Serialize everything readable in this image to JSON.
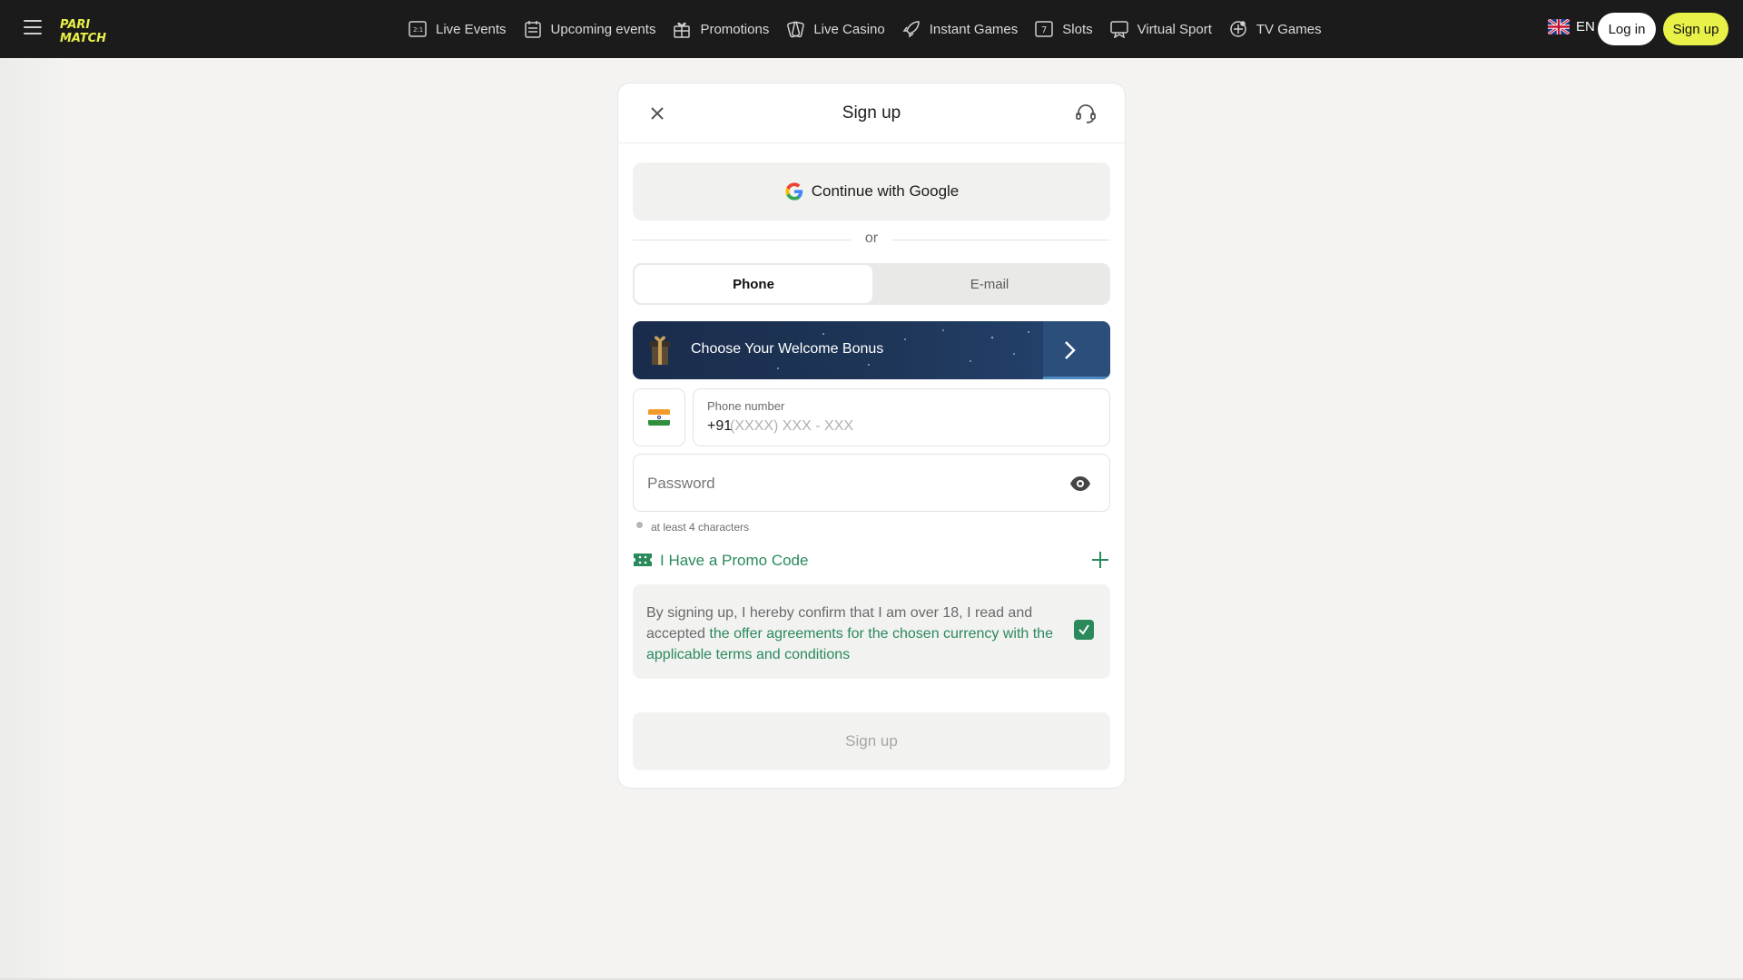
{
  "header": {
    "logo_text": "PARIMATCH",
    "nav": [
      {
        "label": "Live Events",
        "icon": "live-events-icon"
      },
      {
        "label": "Upcoming events",
        "icon": "calendar-icon"
      },
      {
        "label": "Promotions",
        "icon": "gift-icon"
      },
      {
        "label": "Live Casino",
        "icon": "cards-icon"
      },
      {
        "label": "Instant Games",
        "icon": "rocket-icon"
      },
      {
        "label": "Slots",
        "icon": "slot-icon"
      },
      {
        "label": "Virtual Sport",
        "icon": "virtual-sport-icon"
      },
      {
        "label": "TV Games",
        "icon": "tv-games-icon"
      }
    ],
    "language": "EN",
    "login_label": "Log in",
    "signup_label": "Sign up"
  },
  "modal": {
    "title": "Sign up",
    "google_label": "Continue with Google",
    "or_label": "or",
    "tabs": {
      "phone": "Phone",
      "email": "E-mail"
    },
    "active_tab": "phone",
    "bonus_label": "Choose Your Welcome Bonus",
    "phone": {
      "label": "Phone number",
      "prefix": "+91",
      "placeholder": "(XXXX) XXX - XXX"
    },
    "password": {
      "placeholder": "Password"
    },
    "password_hint": "at least 4 characters",
    "promo_label": "I Have a Promo Code",
    "terms": {
      "prefix": "By signing up, I hereby confirm that I am over 18, I read and accepted ",
      "link": "the offer agreements for the chosen currency with the applicable terms and conditions",
      "checked": true
    },
    "submit_label": "Sign up"
  },
  "colors": {
    "header_bg": "#1b1b1b",
    "brand_yellow": "#e8f148",
    "accent_green": "#2a8a5c",
    "bonus_bg": "#1e3658"
  }
}
